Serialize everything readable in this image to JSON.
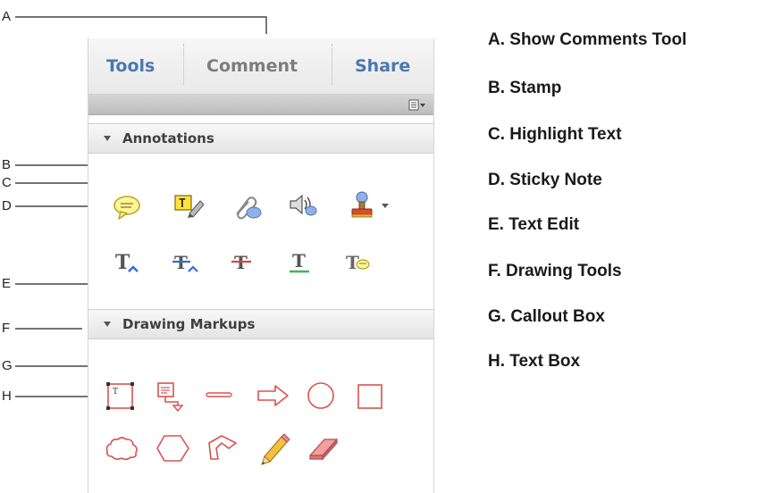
{
  "tabs": [
    {
      "label": "Tools",
      "color": "#4a78b0"
    },
    {
      "label": "Comment",
      "color": "#7d7d7d"
    },
    {
      "label": "Share",
      "color": "#4a78b0"
    }
  ],
  "options_icon": "options-menu-icon",
  "sections": {
    "annotations": "Annotations",
    "drawing_markups": "Drawing Markups"
  },
  "annotation_tools": [
    "sticky-note-icon",
    "highlight-text-icon",
    "attach-file-icon",
    "record-audio-icon",
    "stamp-icon",
    "insert-text-icon",
    "replace-text-icon",
    "strikethrough-icon",
    "underline-icon",
    "add-note-to-text-icon"
  ],
  "drawing_tools": [
    "text-box-icon",
    "callout-icon",
    "line-icon",
    "arrow-icon",
    "oval-icon",
    "rectangle-icon",
    "cloud-icon",
    "polygon-icon",
    "connected-lines-icon",
    "pencil-icon",
    "eraser-icon"
  ],
  "callout_letters": [
    "A",
    "B",
    "C",
    "D",
    "E",
    "F",
    "G",
    "H"
  ],
  "legend": [
    "A.  Show Comments Tool",
    "B. Stamp",
    "C. Highlight Text",
    "D. Sticky Note",
    "E. Text Edit",
    "F. Drawing Tools",
    "G. Callout Box",
    "H. Text Box"
  ],
  "colors": {
    "tab_blue": "#4a78b0",
    "tab_gray": "#7d7d7d",
    "markup_red": "#d9534f"
  }
}
